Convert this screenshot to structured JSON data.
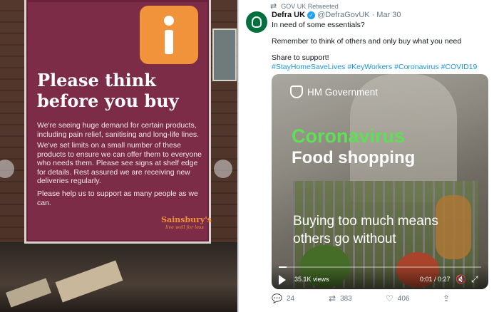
{
  "poster": {
    "heading": "Please think before you buy",
    "paragraphs": [
      "We're seeing huge demand for certain products, including pain relief, sanitising and long-life lines.",
      "We've set limits on a small number of these products to ensure we can offer them to everyone who needs them. Please see signs at shelf edge for details. Rest assured we are receiving new deliveries regularly.",
      "Please help us to support as many people as we can."
    ],
    "brand": "Sainsbury's",
    "brand_tagline": "live well for less",
    "badge_icon": "info-icon",
    "colors": {
      "background": "#7d2c47",
      "badge": "#f0933a"
    }
  },
  "tweet": {
    "retweet_label": "GOV UK Retweeted",
    "display_name": "Defra UK",
    "handle": "@DefraGovUK",
    "separator": "·",
    "date": "Mar 30",
    "lines": [
      "In need of some essentials?",
      "Remember to think of others and only buy what you need",
      "Share to support!"
    ],
    "hashtags": [
      "#StayHomeSaveLives",
      "#KeyWorkers",
      "#Coronavirus",
      "#COVID19"
    ],
    "video": {
      "brand": "HM Government",
      "title": "Coronavirus",
      "subtitle": "Food shopping",
      "caption": "Buying too much means others go without",
      "views": "35.1K views",
      "time": "0:01 / 0:27",
      "progress": 0.037
    },
    "actions": {
      "replies": "24",
      "retweets": "383",
      "likes": "406"
    },
    "colors": {
      "link": "#1b95e0",
      "verified": "#1da1f2",
      "muted": "#657786",
      "title_green": "#5ee055"
    }
  }
}
